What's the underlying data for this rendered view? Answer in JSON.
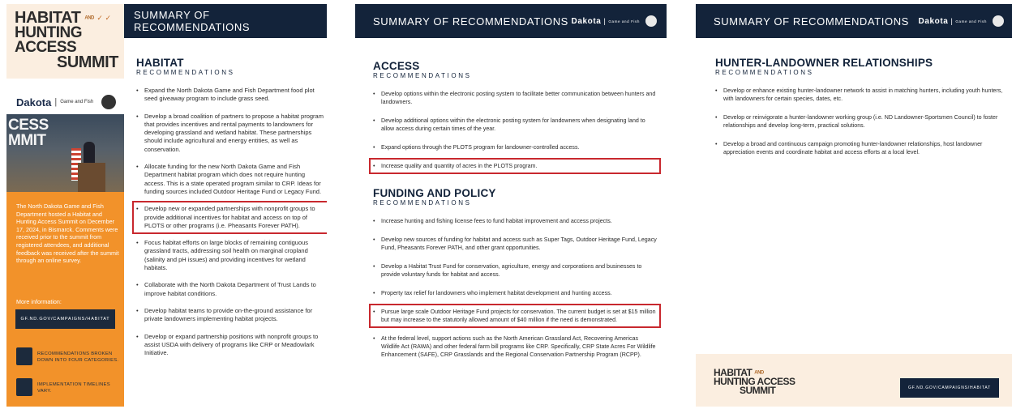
{
  "panel1": {
    "logo": {
      "line1": "HABITAT",
      "the": "AND",
      "line2": "HUNTING ACCESS",
      "line3": "SUMMIT"
    },
    "brand": {
      "dakota": "Dakota",
      "sep": "|",
      "game_fish": "Game and Fish"
    },
    "photo_text": [
      "CESS",
      "MMIT"
    ],
    "side_text": "The North Dakota Game and Fish Department hosted a Habitat and Hunting Access Summit on December 17, 2024, in Bismarck. Comments were received prior to the summit from registered attendees, and additional feedback was received after the summit through an online survey.",
    "more_info": "More information:",
    "url": "GF.ND.GOV/CAMPAIGNS/HABITAT",
    "features": [
      {
        "icon": "checklist-icon",
        "text": "RECOMMENDATIONS BROKEN DOWN INTO FOUR CATEGORIES."
      },
      {
        "icon": "calendar-icon",
        "text": "IMPLEMENTATION TIMELINES VARY."
      }
    ],
    "header": "SUMMARY OF RECOMMENDATIONS",
    "section": {
      "title": "HABITAT",
      "subtitle": "RECOMMENDATIONS",
      "items": [
        "Expand the North Dakota Game and Fish Department food plot seed giveaway program to include grass seed.",
        "Develop a broad coalition of partners to propose a habitat program that provides incentives and rental payments to landowners for developing grassland and wetland habitat. These partnerships should include agricultural and energy entities, as well as conservation.",
        "Allocate funding for the new North Dakota Game and Fish Department habitat program which does not require hunting access. This is a state operated program similar to CRP. Ideas for funding sources included Outdoor Heritage Fund or Legacy Fund.",
        "Develop new or expanded partnerships with nonprofit groups to provide additional incentives for habitat and access on top of PLOTS or other programs (i.e. Pheasants Forever PATH).",
        "Focus habitat efforts on large blocks of remaining contiguous grassland tracts, addressing soil health on marginal cropland (salinity and pH issues) and providing incentives for wetland habitats.",
        "Collaborate with the North Dakota Department of Trust Lands to improve habitat conditions.",
        "Develop habitat teams to provide on-the-ground assistance for private landowners implementing habitat projects.",
        "Develop or expand partnership positions with nonprofit groups to assist USDA with delivery of programs like CRP or Meadowlark Initiative."
      ]
    }
  },
  "panel2": {
    "header": "SUMMARY OF RECOMMENDATIONS",
    "brand": {
      "dakota": "Dakota",
      "sep": "|",
      "game_fish": "Game and Fish"
    },
    "access": {
      "title": "ACCESS",
      "subtitle": "RECOMMENDATIONS",
      "items": [
        "Develop options within the electronic posting system to facilitate better communication between hunters and landowners.",
        "Develop additional options within the electronic posting system for landowners when designating land to allow access during certain times of the year.",
        "Expand options through the PLOTS program for landowner-controlled access.",
        "Increase quality and quantity of acres in the PLOTS program."
      ]
    },
    "funding": {
      "title": "FUNDING AND POLICY",
      "subtitle": "RECOMMENDATIONS",
      "items": [
        "Increase hunting and fishing license fees to fund habitat improvement and access projects.",
        "Develop new sources of funding for habitat and access such as Super Tags, Outdoor Heritage Fund, Legacy Fund, Pheasants Forever PATH, and other grant opportunities.",
        "Develop a Habitat Trust Fund for conservation, agriculture, energy and corporations and businesses to provide voluntary funds for habitat and access.",
        "Property tax relief for landowners who implement habitat development and hunting access.",
        "Pursue large scale Outdoor Heritage Fund projects for conservation. The current budget is set at $15 million but may increase to the statutorily allowed amount of $40 million if the need is demonstrated.",
        "At the federal level, support actions such as the North American Grassland Act, Recovering Americas Wildlife Act (RAWA) and other federal farm bill programs like CRP. Specifically, CRP State Acres For Wildlife Enhancement (SAFE), CRP Grasslands and the Regional Conservation Partnership Program (RCPP)."
      ]
    }
  },
  "panel3": {
    "header": "SUMMARY OF RECOMMENDATIONS",
    "brand": {
      "dakota": "Dakota",
      "sep": "|",
      "game_fish": "Game and Fish"
    },
    "section": {
      "title": "HUNTER-LANDOWNER RELATIONSHIPS",
      "subtitle": "RECOMMENDATIONS",
      "items": [
        "Develop or enhance existing hunter-landowner network to assist in matching hunters, including youth hunters, with landowners for certain species, dates, etc.",
        "Develop or reinvigorate a hunter-landowner working group (i.e. ND Landowner-Sportsmen Council) to foster relationships and develop long-term, practical solutions.",
        "Develop a broad and continuous campaign promoting hunter-landowner relationships, host landowner appreciation events and coordinate habitat and access efforts at a local level."
      ]
    },
    "footer_logo": {
      "line1": "HABITAT",
      "the": "AND",
      "line2": "HUNTING ACCESS",
      "line3": "SUMMIT"
    },
    "url": "GF.ND.GOV/CAMPAIGNS/HABITAT"
  },
  "colors": {
    "navy": "#13233a",
    "orange": "#f2922a",
    "cream": "#fbeee0",
    "highlight": "#c8282e"
  }
}
